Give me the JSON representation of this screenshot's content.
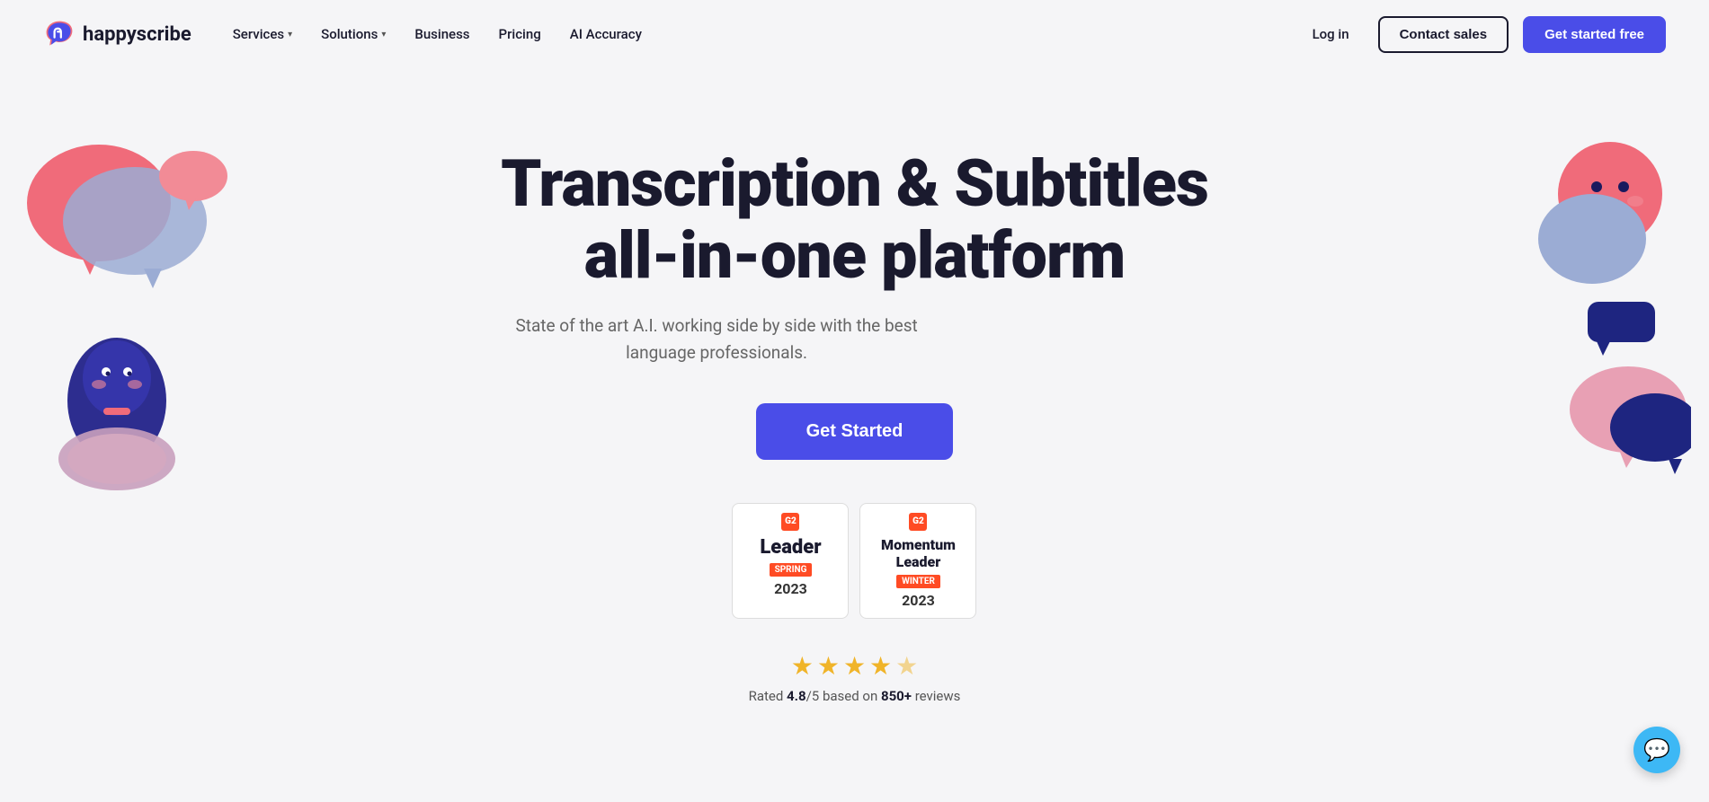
{
  "nav": {
    "logo_text": "happyscribe",
    "links": [
      {
        "label": "Services",
        "has_dropdown": true
      },
      {
        "label": "Solutions",
        "has_dropdown": true
      },
      {
        "label": "Business",
        "has_dropdown": false
      },
      {
        "label": "Pricing",
        "has_dropdown": false
      },
      {
        "label": "AI Accuracy",
        "has_dropdown": false
      }
    ],
    "login_label": "Log in",
    "contact_label": "Contact sales",
    "get_started_label": "Get started free"
  },
  "hero": {
    "title_line1": "Transcription & Subtitles",
    "title_line2": "all-in-one platform",
    "subtitle": "State of the art A.I. working side by side with the best language professionals.",
    "cta_label": "Get Started",
    "badge1": {
      "g2_label": "G2",
      "type": "Leader",
      "season": "SPRING",
      "year": "2023"
    },
    "badge2": {
      "g2_label": "G2",
      "type": "Momentum Leader",
      "season": "WINTER",
      "year": "2023"
    },
    "rating_value": "4.8",
    "rating_max": "5",
    "rating_count": "850+",
    "rating_text": "Rated 4.8/5 based on 850+ reviews"
  },
  "chat": {
    "icon": "💬"
  }
}
